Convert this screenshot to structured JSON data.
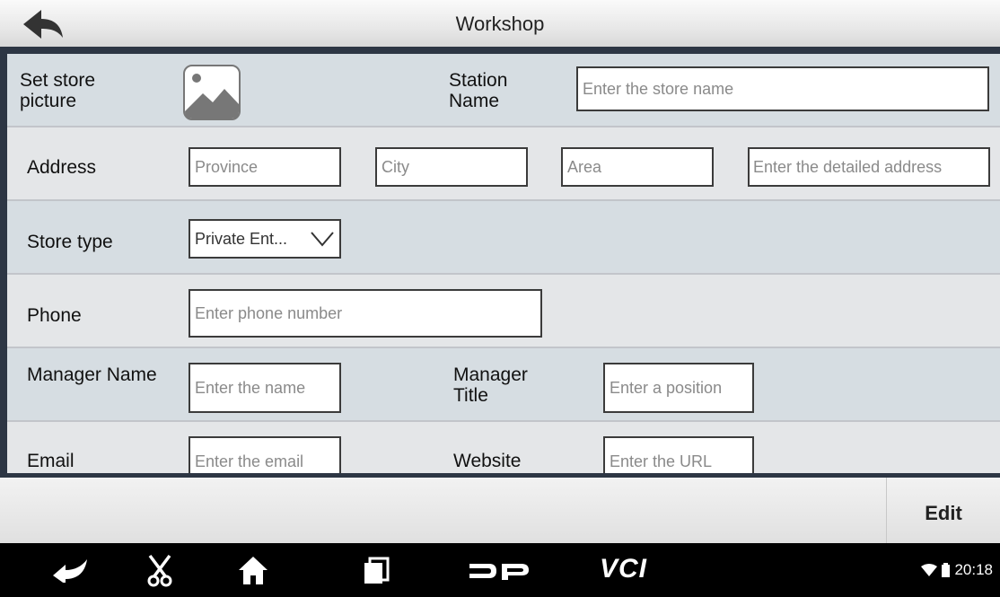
{
  "header": {
    "title": "Workshop"
  },
  "form": {
    "picture_label": "Set store picture",
    "station_label": "Station Name",
    "station_placeholder": "Enter the store name",
    "address_label": "Address",
    "province_placeholder": "Province",
    "city_placeholder": "City",
    "area_placeholder": "Area",
    "detail_placeholder": "Enter the detailed address",
    "store_type_label": "Store type",
    "store_type_value": "Private Ent...",
    "phone_label": "Phone",
    "phone_placeholder": "Enter phone number",
    "manager_name_label": "Manager Name",
    "manager_name_placeholder": "Enter the name",
    "manager_title_label": "Manager Title",
    "manager_title_placeholder": "Enter a position",
    "email_label": "Email",
    "email_placeholder": "Enter the email",
    "website_label": "Website",
    "website_placeholder": "Enter the URL"
  },
  "actions": {
    "edit_label": "Edit"
  },
  "navbar": {
    "icons": [
      "back-icon",
      "scissors-icon",
      "home-icon",
      "recent-apps-icon",
      "dp-icon",
      "vci-icon"
    ],
    "vci_label": "VCI",
    "clock": "20:18"
  },
  "colors": {
    "frame": "#2d3644",
    "row_tint": "#d6dde2",
    "row_plain": "#e4e6e8"
  }
}
